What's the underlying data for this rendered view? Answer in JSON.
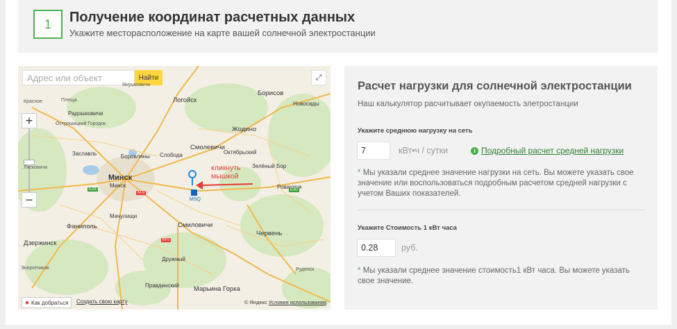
{
  "step": {
    "number": "1",
    "title": "Получение координат расчетных данных",
    "subtitle": "Укажите месторасположение на карте вашей солнечной электростанции"
  },
  "map": {
    "search_placeholder": "Адрес или объект",
    "find_label": "Найти",
    "expand_icon": "expand-icon",
    "zoom_in": "+",
    "zoom_out": "−",
    "route_label": "Как добраться",
    "create_map": "Создать свою карту",
    "copyright": "© Яндекс",
    "terms": "Условия использования",
    "annotation_line1": "кликнуть",
    "annotation_line2": "мышкой",
    "airport_label": "MSQ",
    "labels": {
      "minsk": "Минск",
      "minsk2": "Минск",
      "borisov": "Борисов",
      "smolevichi": "Смолевичи",
      "zhodino": "Жодино",
      "logoysk": "Логойск",
      "dzerzhinsk": "Дзержинск",
      "fanipol": "Фаниполь",
      "machulishchi": "Мачулищи",
      "smilovichi": "Смиловичи",
      "cherven": "Червень",
      "maryina_gorka": "Марьина Горка",
      "druzhny": "Дружный",
      "pravdinsky": "Правдинский",
      "rovaniche": "Рованичи",
      "zeleny_bor": "Зелёный Бор",
      "oktyabrsky": "Октябрьский",
      "borovlyany": "Боровляны",
      "zaslavl": "Заславль",
      "sloboda": "Слобода",
      "novosady": "Новосады",
      "lyaskovichi": "Лясковичи",
      "radoshkovichi": "Радошковичи",
      "krasnoe": "Красное",
      "energetikov": "Энергетиков",
      "yanushkovichi": "Янушковичи",
      "rudensk": "Руденск",
      "plesha": "Плеща",
      "ostroshitsky": "Острошицкий Городок",
      "m9": "M-9",
      "m5": "M-5",
      "e28": "E28",
      "e30": "E30"
    }
  },
  "calc": {
    "title": "Расчет нагрузки для солнечной электростанции",
    "description": "Наш калькулятор расчитывает окупаемость элетростанции",
    "load_label": "Укажите среднюю нагрузку на сеть",
    "load_value": "7",
    "load_unit": "кВт•ч / сутки",
    "detail_link": "Подробный расчет средней нагрузки",
    "load_note": "Мы указали среднее значение нагрузки на сеть. Вы можете указать свое значение или воспользоваться подробным расчетом средней нагрузки с учетом Ваших показателей.",
    "price_label": "Укажите Стоимость 1 кВт часа",
    "price_value": "0.28",
    "price_unit": "руб.",
    "price_note": "Мы указали среднее значение стоимость1 кВт часа. Вы можете указать свое значение.",
    "accent_color": "#4caf50"
  }
}
